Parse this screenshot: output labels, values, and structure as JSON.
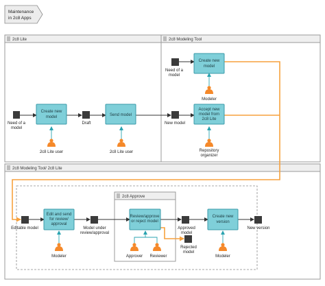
{
  "header": {
    "line1": "Maintenance",
    "line2": "in 2c8 Apps"
  },
  "pools": {
    "lite": "2c8 Lite",
    "modeling": "2c8 Modeling Tool",
    "combined": "2c8 Modeling Tool/ 2c8 Lite",
    "approve": "2c8 Approve"
  },
  "tasks": {
    "create_lite": [
      "Create new",
      "model"
    ],
    "send_model": [
      "Send model"
    ],
    "create_modeling": [
      "Create new",
      "model"
    ],
    "accept_model": [
      "Accept new",
      "model from",
      "2c8 Lite"
    ],
    "edit_send": [
      "Edit and send",
      "for review/",
      "approval"
    ],
    "review_approve": [
      "Review/approve",
      "or reject model"
    ],
    "create_version": [
      "Create new",
      "version"
    ]
  },
  "documents": {
    "need_model_lite": [
      "Need of a",
      "model"
    ],
    "draft": [
      "Draft"
    ],
    "need_model_modeling": [
      "Need of a",
      "model"
    ],
    "new_model": [
      "New model"
    ],
    "editable_model": [
      "Editable model"
    ],
    "model_under_review": [
      "Model under",
      "review/approval"
    ],
    "approved_model": [
      "Approved",
      "model"
    ],
    "rejected_model": [
      "Rejected",
      "model"
    ],
    "new_version": [
      "New version"
    ]
  },
  "roles": {
    "lite_user_1": [
      "2c8 Lite user"
    ],
    "lite_user_2": [
      "2c8 Lite user"
    ],
    "modeler_top": [
      "Modeler"
    ],
    "repository_organizer": [
      "Repository",
      "organizer"
    ],
    "modeler_edit": [
      "Modeler"
    ],
    "approver": [
      "Approver"
    ],
    "reviewer": [
      "Reviewer"
    ],
    "modeler_version": [
      "Modeler"
    ]
  },
  "colors": {
    "task_fill": "#7fcfd9",
    "role_fill": "#f5892a",
    "handoff_line": "#f7a13d",
    "document_fill": "#3b3b3b"
  }
}
